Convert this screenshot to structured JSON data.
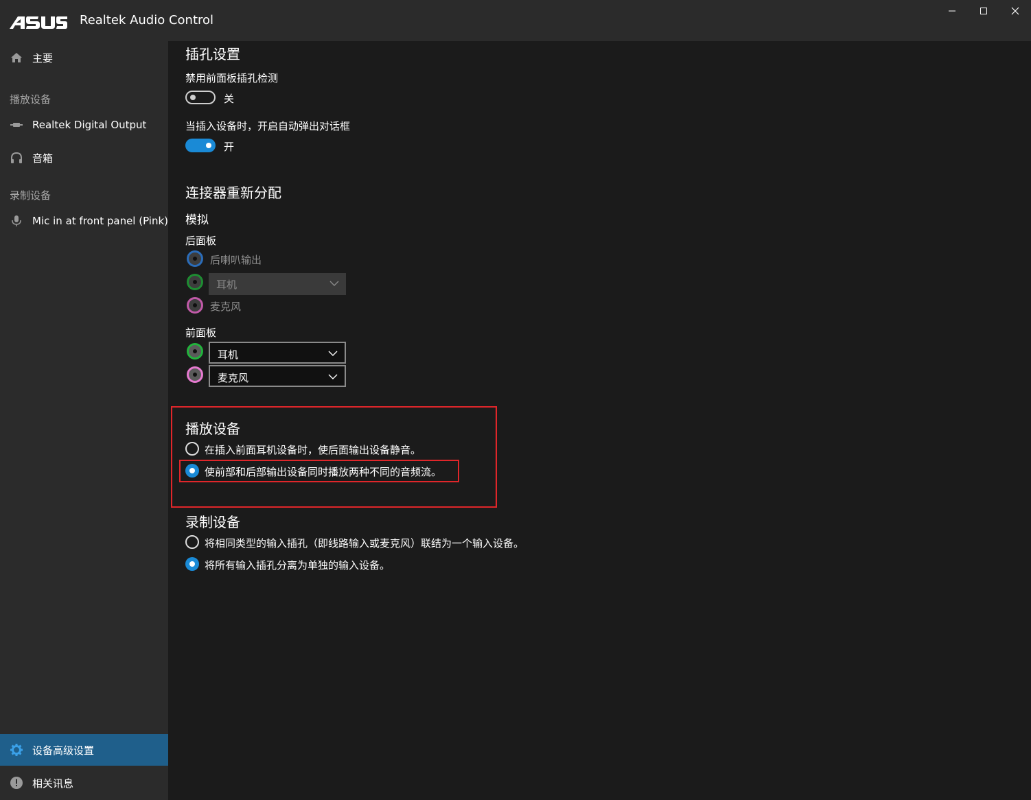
{
  "window": {
    "brand": "ASUS",
    "title": "Realtek Audio Control"
  },
  "sidebar": {
    "home": "主要",
    "playback_group": "播放设备",
    "playback_items": [
      "Realtek Digital Output",
      "音箱"
    ],
    "recording_group": "录制设备",
    "recording_items": [
      "Mic in at front panel (Pink)"
    ],
    "advanced": "设备高级设置",
    "info": "相关讯息"
  },
  "jack_settings": {
    "title": "插孔设置",
    "disable_front_detect": {
      "label": "禁用前面板插孔检测",
      "state": "关",
      "on": false
    },
    "auto_popup": {
      "label": "当插入设备时，开启自动弹出对话框",
      "state": "开",
      "on": true
    }
  },
  "connector": {
    "title": "连接器重新分配",
    "analog": "模拟",
    "rear_panel": {
      "label": "后面板",
      "jacks": [
        {
          "label": "后喇叭输出",
          "color": "#2b6cb8"
        },
        {
          "value": "耳机",
          "color": "#1e8c32"
        },
        {
          "label": "麦克风",
          "color": "#c05aa8"
        }
      ]
    },
    "front_panel": {
      "label": "前面板",
      "jacks": [
        {
          "value": "耳机",
          "color": "#22b33c"
        },
        {
          "value": "麦克风",
          "color": "#e67ad0"
        }
      ]
    }
  },
  "playback": {
    "title": "播放设备",
    "options": [
      {
        "label": "在插入前面耳机设备时，使后面输出设备静音。",
        "selected": false
      },
      {
        "label": "使前部和后部输出设备同时播放两种不同的音频流。",
        "selected": true
      }
    ]
  },
  "recording": {
    "title": "录制设备",
    "options": [
      {
        "label": "将相同类型的输入插孔（即线路输入或麦克风）联结为一个输入设备。",
        "selected": false
      },
      {
        "label": "将所有输入插孔分离为单独的输入设备。",
        "selected": true
      }
    ]
  },
  "colors": {
    "accent": "#1a8ad6",
    "highlight": "#e0262a",
    "sidebar_active": "#1f5f8b"
  }
}
